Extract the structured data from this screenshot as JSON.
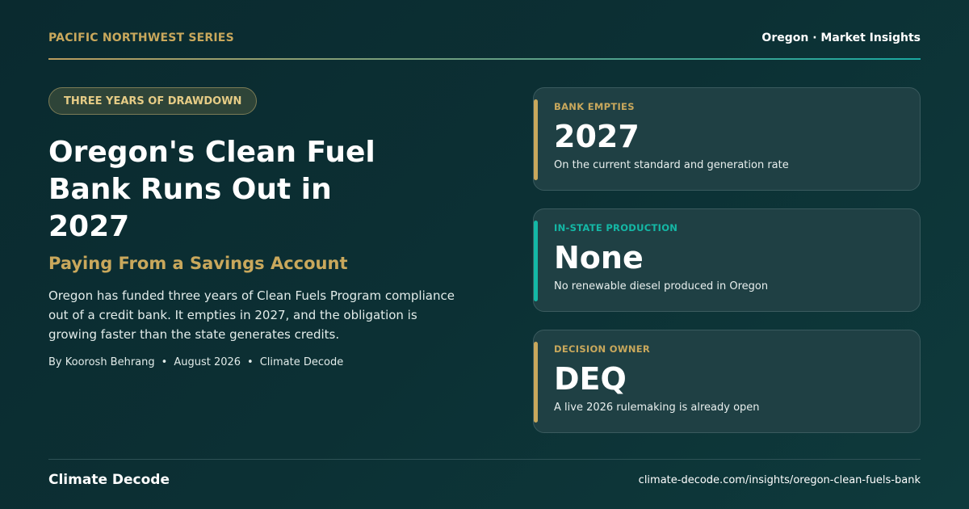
{
  "header": {
    "series": "PACIFIC NORTHWEST SERIES",
    "right": "Oregon · Market Insights"
  },
  "tag": "THREE YEARS OF DRAWDOWN",
  "headline": "Oregon's Clean Fuel Bank Runs Out in 2027",
  "subhead": "Paying From a Savings Account",
  "summary": "Oregon has funded three years of Clean Fuels Program compliance out of a credit bank. It empties in 2027, and the obligation is growing faster than the state generates credits.",
  "byline": {
    "author": "By Koorosh Behrang",
    "date": "August 2026",
    "publication": "Climate Decode",
    "separator": "•"
  },
  "cards": [
    {
      "label": "BANK EMPTIES",
      "value": "2027",
      "description": "On the current standard and generation rate",
      "accent_color": "#c9a85c",
      "label_color": "#c9a85c"
    },
    {
      "label": "IN-STATE PRODUCTION",
      "value": "None",
      "description": "No renewable diesel produced in Oregon",
      "accent_color": "#14b8a6",
      "label_color": "#14b8a6"
    },
    {
      "label": "DECISION OWNER",
      "value": "DEQ",
      "description": "A live 2026 rulemaking is already open",
      "accent_color": "#c9a85c",
      "label_color": "#c9a85c"
    }
  ],
  "footer": {
    "brand": "Climate Decode",
    "url": "climate-decode.com/insights/oregon-clean-fuels-bank"
  },
  "colors": {
    "gold": "#c9a85c",
    "teal": "#14b8a6",
    "background": "#0c3034"
  }
}
